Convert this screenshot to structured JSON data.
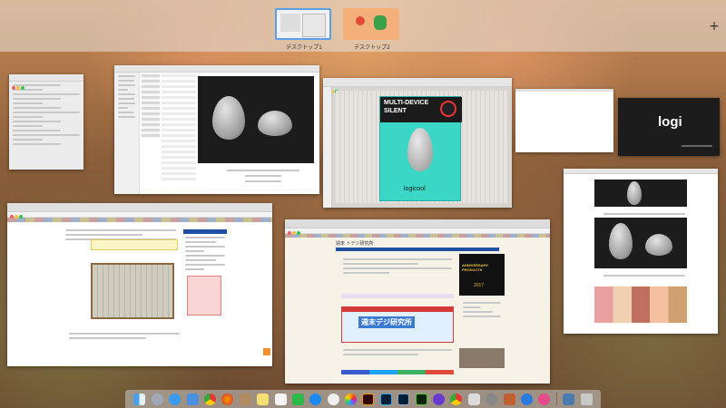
{
  "spaces": {
    "desktop1_label": "デスクトップ1",
    "desktop2_label": "デスクトップ2",
    "add_label": "+"
  },
  "product_window": {
    "product_line1": "MULTI-DEVICE",
    "product_line2": "SILENT",
    "brand": "logicool"
  },
  "logi_window": {
    "brand": "logi"
  },
  "blog_window": {
    "site_title": "週末 トデジ研究所",
    "banner_text": "週末デジ研究所",
    "promo_text": "ANNIVERSARY PRODUCTS",
    "promo_year": "2017"
  },
  "dock": {
    "icons": [
      "finder",
      "launchpad",
      "safari",
      "mail",
      "chrome",
      "firefox",
      "contacts",
      "notes",
      "reminders",
      "evernote",
      "app-store",
      "itunes",
      "photos",
      "illustrator",
      "photoshop",
      "lightroom",
      "dreamweaver",
      "imovie",
      "chrome2",
      "preview",
      "system-preferences",
      "tools",
      "safari2",
      "messages",
      "facetime",
      "trash"
    ]
  },
  "colors": {
    "window_highlight": "#5aa0e8",
    "logi_teal": "#3ad6c6",
    "blog_blue": "#1e4fa3"
  }
}
